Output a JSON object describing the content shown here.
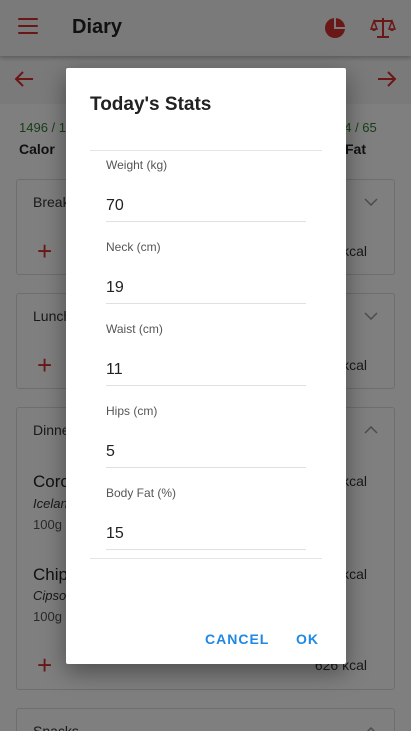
{
  "appbar": {
    "title": "Diary",
    "icons": [
      "menu-icon",
      "pie-chart-icon",
      "scale-icon"
    ]
  },
  "summary": {
    "left_value": "1496 / 1",
    "left_label": "Calor",
    "right_value": "54 / 65",
    "right_label": "Fat"
  },
  "meals": [
    {
      "name": "Break",
      "kcal": "kcal"
    },
    {
      "name": "Lunch",
      "kcal": "kcal"
    },
    {
      "name": "Dinne",
      "kcal": "626 kcal",
      "foods": [
        {
          "name": "Coro",
          "brand": "Icelan",
          "qty": "100g",
          "kcal": "4 kcal"
        },
        {
          "name": "Chip",
          "brand": "Cipso",
          "qty": "100g",
          "kcal": "2 kcal"
        }
      ]
    },
    {
      "name": "Snacks"
    }
  ],
  "dialog": {
    "title": "Today's Stats",
    "fields": [
      {
        "label": "Weight (kg)",
        "value": "70"
      },
      {
        "label": "Neck (cm)",
        "value": "19"
      },
      {
        "label": "Waist (cm)",
        "value": "11"
      },
      {
        "label": "Hips (cm)",
        "value": "5"
      },
      {
        "label": "Body Fat (%)",
        "value": "15"
      }
    ],
    "cancel_label": "CANCEL",
    "ok_label": "OK"
  },
  "colors": {
    "accent": "#d32f2f",
    "button": "#1e88e5",
    "summary_green": "#2e7d32"
  }
}
